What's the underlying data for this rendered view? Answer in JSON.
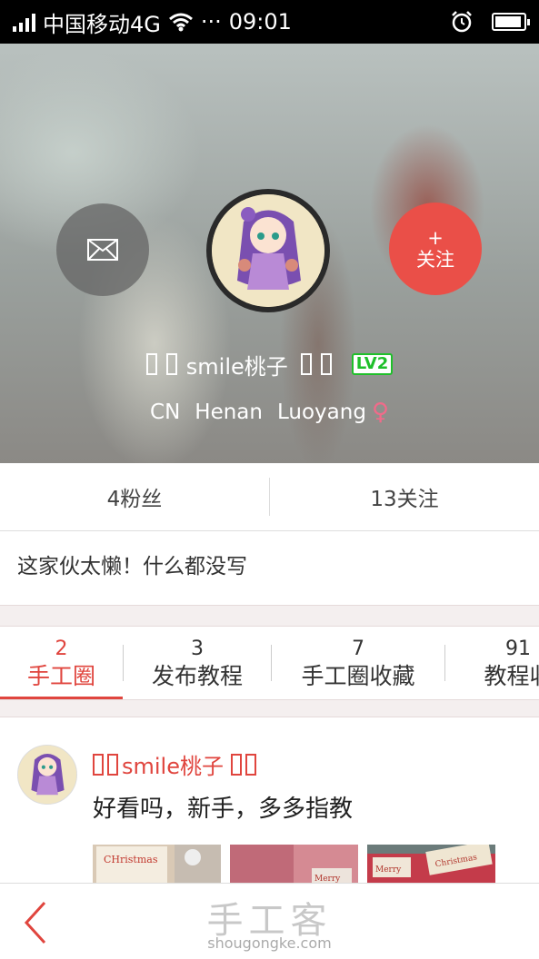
{
  "status_bar": {
    "carrier": "中国移动4G",
    "dots": "···",
    "time": "09:01"
  },
  "profile": {
    "username": "smile桃子",
    "level": "LV2",
    "location": [
      "CN",
      "Henan",
      "Luoyang"
    ],
    "gender_symbol": "♀",
    "follow_plus": "+",
    "follow_label": "关注",
    "message_icon": "envelope-icon",
    "followers": "4粉丝",
    "following": "13关注",
    "bio": "这家伙太懒！什么都没写"
  },
  "tabs": [
    {
      "count": "2",
      "label": "手工圈"
    },
    {
      "count": "3",
      "label": "发布教程"
    },
    {
      "count": "7",
      "label": "手工圈收藏"
    },
    {
      "count": "91",
      "label": "教程收"
    }
  ],
  "post": {
    "author": "smile桃子",
    "text": "好看吗，新手，多多指教",
    "thumb_texts": [
      "CHristmas",
      "Merry",
      "Christmas"
    ]
  },
  "bottom": {
    "brand": "手工客",
    "domain": "shougongke.com"
  },
  "colors": {
    "accent": "#e0453e",
    "follow": "#ea4f48",
    "level": "#1fbf2a"
  }
}
